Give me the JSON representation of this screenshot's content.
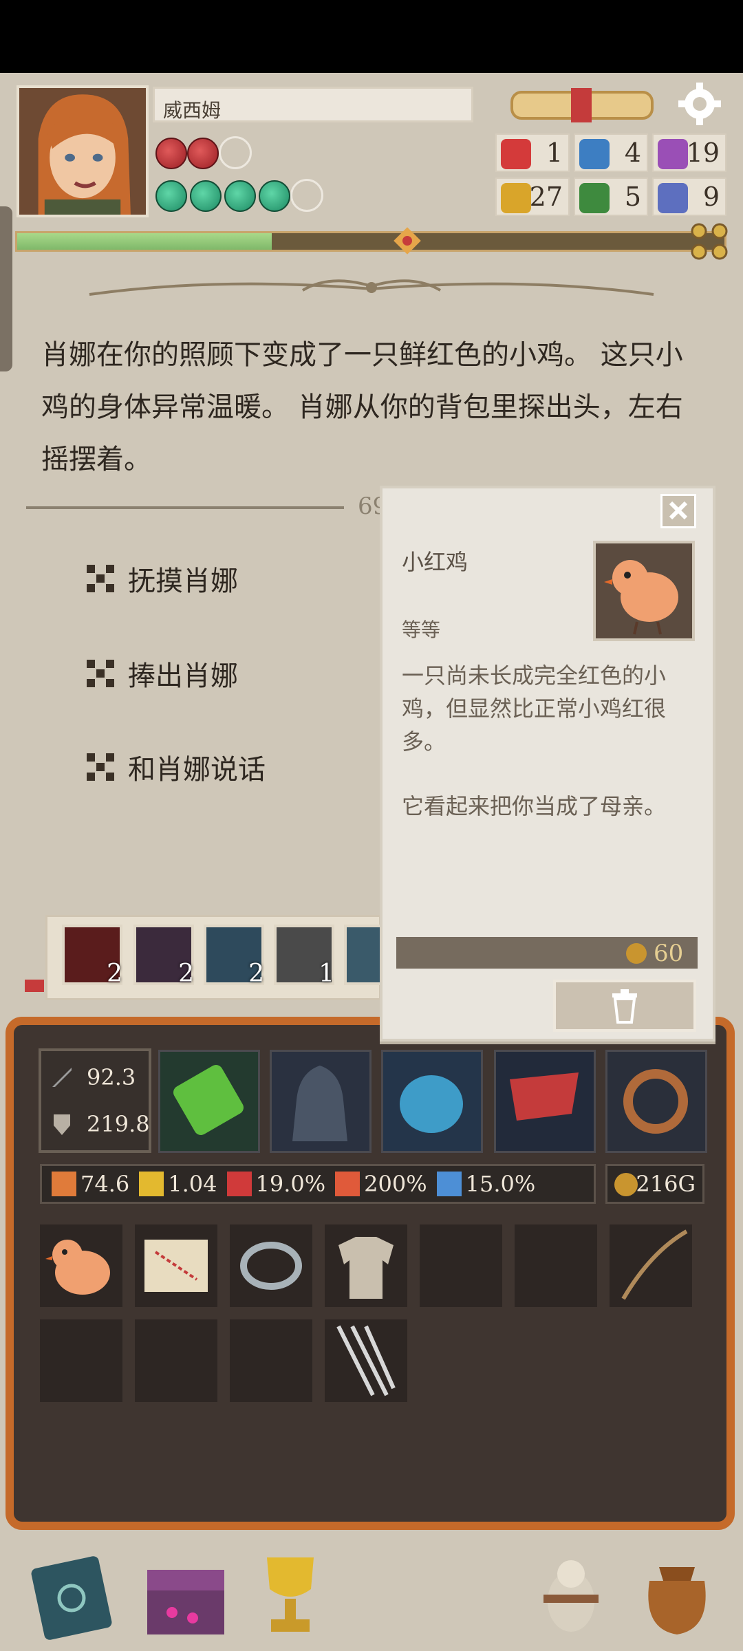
{
  "header": {
    "character_name": "威西姆",
    "hp": {
      "filled": 2,
      "total": 3
    },
    "energy": {
      "filled": 4,
      "total": 5
    },
    "stats": [
      {
        "icon": "red-fist-icon",
        "value": "1",
        "color": "#d43a3a"
      },
      {
        "icon": "blue-star-icon",
        "value": "4",
        "color": "#3d7ec2"
      },
      {
        "icon": "purple-blob-icon",
        "value": "19",
        "color": "#9a4fb6"
      },
      {
        "icon": "gold-coin-icon",
        "value": "27",
        "color": "#d9a52a"
      },
      {
        "icon": "green-heart-icon",
        "value": "5",
        "color": "#3e8a3e"
      },
      {
        "icon": "blue-ring-icon",
        "value": "9",
        "color": "#5d6fbf"
      }
    ],
    "progress": 0.36
  },
  "story": {
    "text": "肖娜在你的照顾下变成了一只鲜红色的小鸡。 这只小鸡的身体异常温暖。 肖娜从你的背包里探出头，左右摇摆着。",
    "divider_number": "69"
  },
  "choices": [
    {
      "label": "抚摸肖娜"
    },
    {
      "label": "捧出肖娜"
    },
    {
      "label": "和肖娜说话"
    }
  ],
  "popup": {
    "title": "小红鸡",
    "subtitle": "等等",
    "desc1": "一只尚未长成完全红色的小鸡，但显然比正常小鸡红很多。",
    "desc2": "它看起来把你当成了母亲。",
    "price": "60"
  },
  "skills": [
    {
      "count": "2",
      "color": "#5a1c1c"
    },
    {
      "count": "2",
      "color": "#3b2a3c"
    },
    {
      "count": "2",
      "color": "#2e4a5c"
    },
    {
      "count": "1",
      "color": "#4a4a4a"
    },
    {
      "count": "",
      "color": "#3a5a6a"
    }
  ],
  "statbox": {
    "attack": "92.3",
    "defense": "219.8"
  },
  "attributes": [
    {
      "icon": "speed-icon",
      "value": "74.6",
      "color": "#e07b3a"
    },
    {
      "icon": "lightning-icon",
      "value": "1.04",
      "color": "#e3b92f"
    },
    {
      "icon": "crit-icon",
      "value": "19.0%",
      "color": "#d03a3a"
    },
    {
      "icon": "crit-damage-icon",
      "value": "200%",
      "color": "#e05a3a"
    },
    {
      "icon": "dodge-icon",
      "value": "15.0%",
      "color": "#4d8fd6"
    }
  ],
  "gold": "216G"
}
